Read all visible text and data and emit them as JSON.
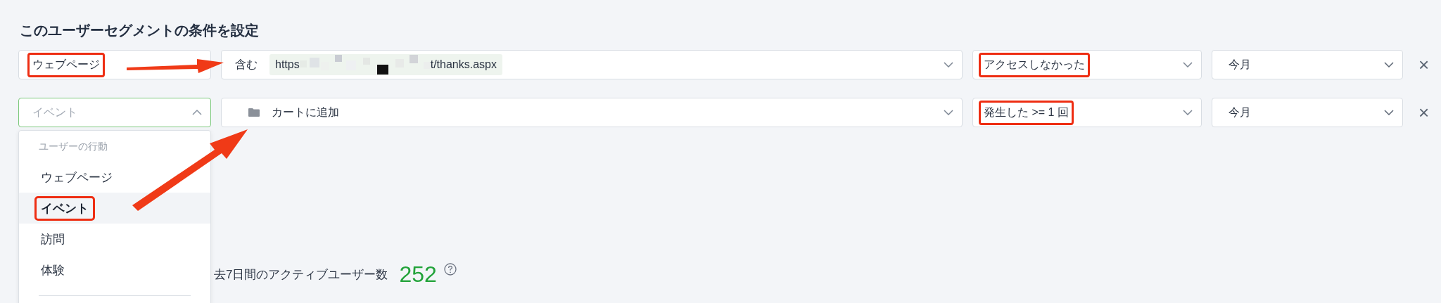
{
  "title": "このユーザーセグメントの条件を設定",
  "conditions": [
    {
      "category": {
        "text": "ウェブページ",
        "kind": "value",
        "open": false,
        "highlighted": true
      },
      "target": {
        "kind": "url",
        "operator": "含む",
        "url_start": "https",
        "url_end": "t/thanks.aspx"
      },
      "action": {
        "text": "アクセスしなかった",
        "highlighted": true
      },
      "period": {
        "text": "今月"
      },
      "remove": "×"
    },
    {
      "category": {
        "text": "イベント",
        "kind": "placeholder",
        "open": true,
        "highlighted": false
      },
      "target": {
        "kind": "event",
        "text": "カートに追加"
      },
      "action": {
        "text": "発生した >= 1 回",
        "highlighted": true
      },
      "period": {
        "text": "今月"
      },
      "remove": "×"
    }
  ],
  "dropdown": {
    "group": "ユーザーの行動",
    "items": [
      {
        "label": "ウェブページ",
        "selected": false,
        "highlighted": false
      },
      {
        "label": "イベント",
        "selected": true,
        "highlighted": true
      },
      {
        "label": "訪問",
        "selected": false,
        "highlighted": false
      },
      {
        "label": "体験",
        "selected": false,
        "highlighted": false
      }
    ]
  },
  "stats": {
    "label": "去7日間のアクティブユーザー数",
    "value": "252"
  }
}
